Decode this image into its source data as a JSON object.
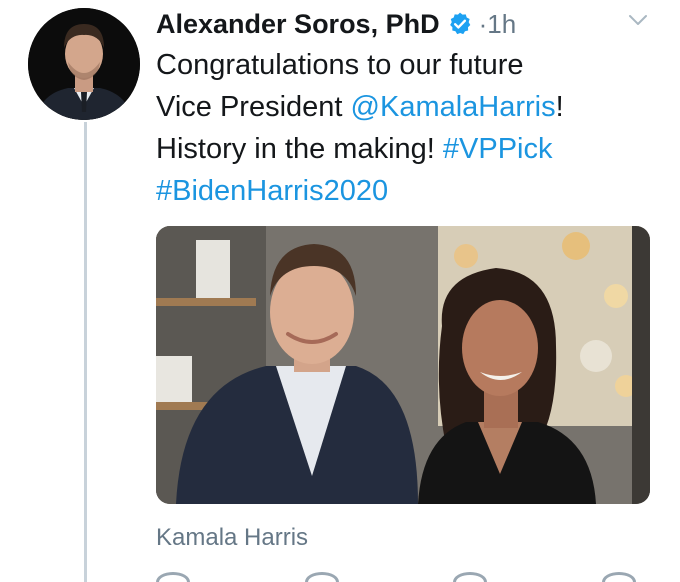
{
  "tweet": {
    "author_name": "Alexander Soros, PhD",
    "separator": "·",
    "time": "1h",
    "text": {
      "line1": "Congratulations to our future",
      "line2_prefix": "Vice President ",
      "mention": "@KamalaHarris",
      "line2_suffix": "!",
      "line3_prefix": "History in the making! ",
      "hashtag1": "#VPPick",
      "hashtag2": "#BidenHarris2020"
    },
    "photo_tag": "Kamala Harris"
  },
  "icons": {
    "verified": "verified-badge-icon",
    "menu": "chevron-down-icon"
  },
  "colors": {
    "link": "#1b95e0",
    "verified_badge": "#1da1f2",
    "secondary_text": "#657786",
    "thread_line": "#c8d2da"
  }
}
